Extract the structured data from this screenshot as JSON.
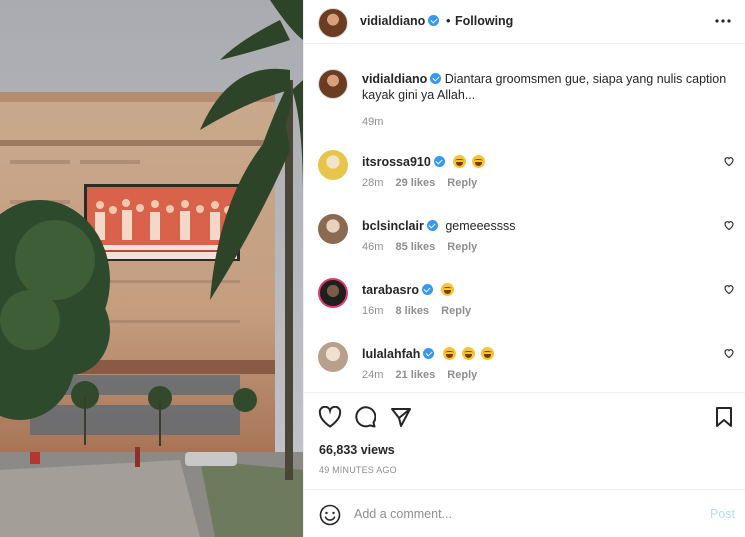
{
  "header": {
    "username": "vidialdiano",
    "separator": "•",
    "follow_state": "Following",
    "more_icon": "more-horizontal-icon"
  },
  "caption": {
    "username": "vidialdiano",
    "text": "Diantara groomsmen gue, siapa yang nulis caption kayak gini ya Allah...",
    "time": "49m"
  },
  "comments": [
    {
      "username": "itsrossa910",
      "emoji_count": 2,
      "time": "28m",
      "likes": "29 likes",
      "reply": "Reply",
      "avatar_color": "#e8c44a"
    },
    {
      "username": "bclsinclair",
      "text": "gemeeessss",
      "time": "46m",
      "likes": "85 likes",
      "reply": "Reply",
      "avatar_color": "#d9b89a"
    },
    {
      "username": "tarabasro",
      "emoji_count": 1,
      "time": "16m",
      "likes": "8 likes",
      "reply": "Reply",
      "avatar_color": "#2a2a2a"
    },
    {
      "username": "lulalahfah",
      "emoji_count": 3,
      "time": "24m",
      "likes": "21 likes",
      "reply": "Reply",
      "avatar_color": "#cfb9a6"
    }
  ],
  "actions": {
    "icons": [
      "heart-icon",
      "comment-icon",
      "share-icon",
      "bookmark-icon"
    ]
  },
  "stats": {
    "views": "66,833 views",
    "posted": "49 MINUTES AGO"
  },
  "comment_bar": {
    "placeholder": "Add a comment...",
    "post_label": "Post"
  },
  "colors": {
    "verified": "#3897f0",
    "post_disabled": "#b2dffc",
    "secondary_text": "#8e8e8e"
  }
}
